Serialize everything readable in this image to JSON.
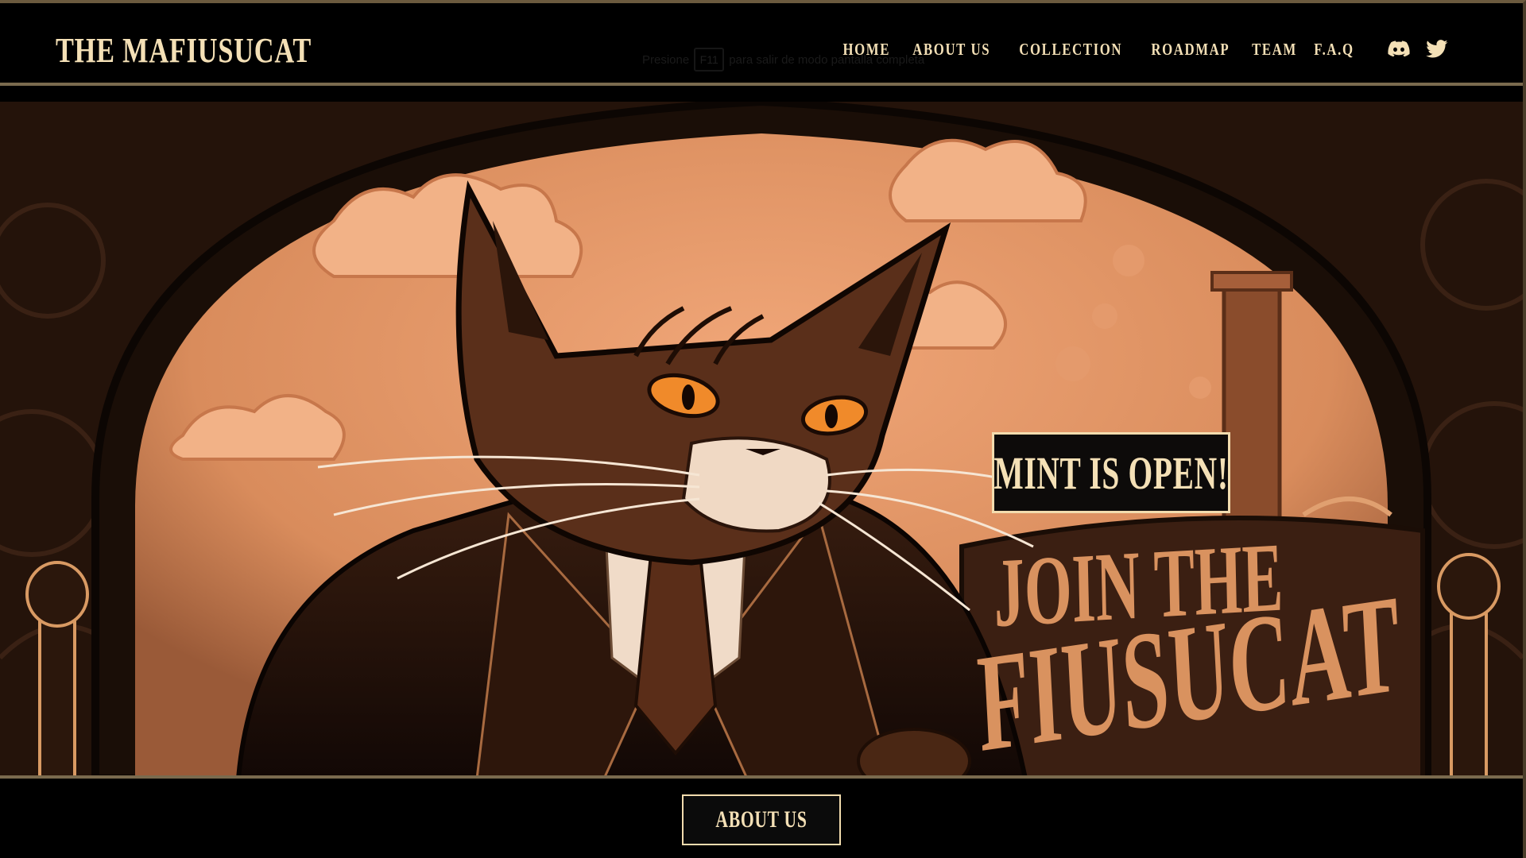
{
  "header": {
    "logo": "THE MAFIUSUCAT",
    "hint": {
      "prefix": "Presione",
      "key": "F11",
      "suffix": "para salir de modo pantalla completa"
    },
    "nav": [
      {
        "label": "HOME"
      },
      {
        "label": "ABOUT US"
      },
      {
        "label": "COLLECTION"
      },
      {
        "label": "ROADMAP"
      },
      {
        "label": "TEAM"
      },
      {
        "label": "F.A.Q"
      }
    ],
    "social": [
      {
        "icon": "discord-icon"
      },
      {
        "icon": "twitter-icon"
      }
    ]
  },
  "hero": {
    "image": "mafia-cat-illustration",
    "mint_label": "MINT IS OPEN!",
    "banner_line1": "JOIN THE",
    "banner_line2": "FIUSUCAT"
  },
  "footer": {
    "about_button": "ABOUT US"
  },
  "colors": {
    "accent_text": "#f4e0b6",
    "background": "#000000",
    "hero_orange": "#d9925f",
    "hero_dark": "#2a160c"
  }
}
